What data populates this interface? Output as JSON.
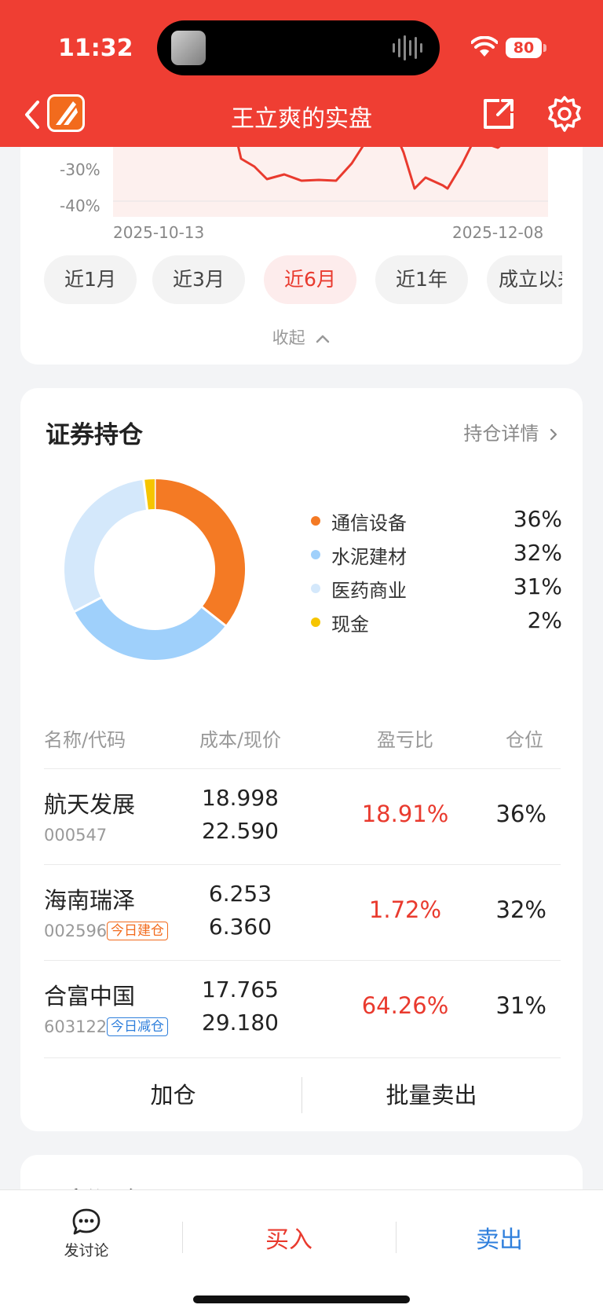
{
  "status_bar": {
    "time": "11:32",
    "battery": "80"
  },
  "nav": {
    "title": "王立爽的实盘"
  },
  "performance_chart": {
    "y_ticks": [
      "-30%",
      "-40%"
    ],
    "x_start": "2025-10-13",
    "x_end": "2025-12-08",
    "ranges": [
      "近1月",
      "近3月",
      "近6月",
      "近1年",
      "成立以来"
    ],
    "active_range": "近6月",
    "collapse_label": "收起"
  },
  "holdings": {
    "title": "证券持仓",
    "detail_link": "持仓详情",
    "allocation": [
      {
        "label": "通信设备",
        "value": "36%",
        "color": "#f47a24"
      },
      {
        "label": "水泥建材",
        "value": "32%",
        "color": "#9fd0fb"
      },
      {
        "label": "医药商业",
        "value": "31%",
        "color": "#d4e8fb"
      },
      {
        "label": "现金",
        "value": "2%",
        "color": "#f6c500"
      }
    ],
    "columns": {
      "name": "名称/代码",
      "price": "成本/现价",
      "ratio": "盈亏比",
      "position": "仓位"
    },
    "rows": [
      {
        "name": "航天发展",
        "code": "000547",
        "tag": "",
        "cost": "18.998",
        "price": "22.590",
        "ratio": "18.91%",
        "position": "36%"
      },
      {
        "name": "海南瑞泽",
        "code": "002596",
        "tag": "今日建仓",
        "cost": "6.253",
        "price": "6.360",
        "ratio": "1.72%",
        "position": "32%"
      },
      {
        "name": "合富中国",
        "code": "603122",
        "tag": "今日减仓",
        "cost": "17.765",
        "price": "29.180",
        "ratio": "64.26%",
        "position": "31%"
      }
    ],
    "actions": {
      "add": "加仓",
      "batch_sell": "批量卖出"
    }
  },
  "next_section": {
    "title": "最新调仓"
  },
  "bottom_bar": {
    "discuss": "发讨论",
    "buy": "买入",
    "sell": "卖出"
  }
}
